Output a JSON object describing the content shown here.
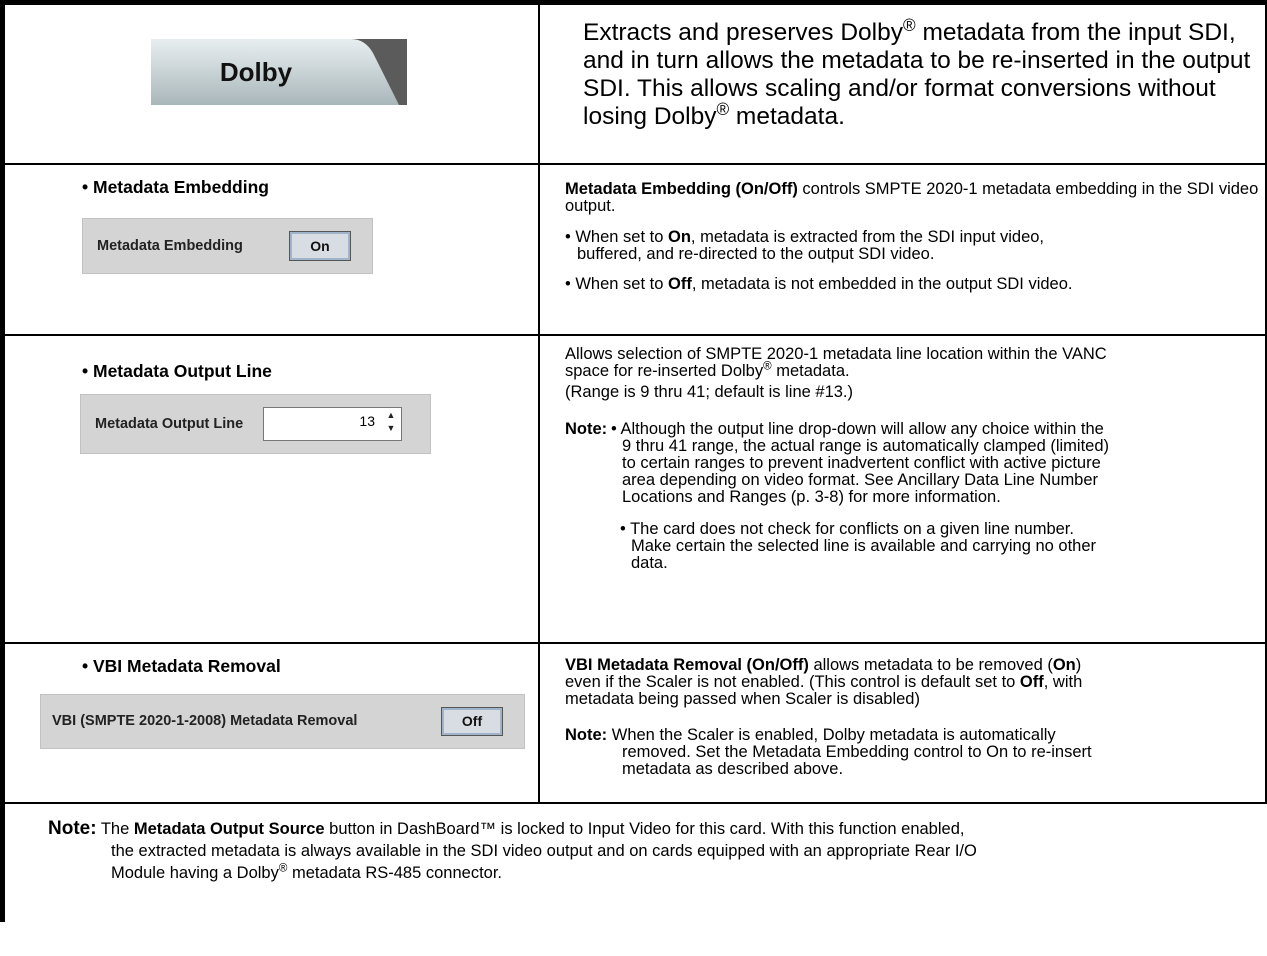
{
  "header": {
    "tab_label": "Dolby",
    "intro_p1": "Extracts and preserves Dolby",
    "intro_p2": " metadata from the input SDI, and in turn allows the metadata to be re-inserted in the output SDI. This allows scaling and/or format conversions without losing Dolby",
    "intro_p3": " metadata.",
    "reg": "®"
  },
  "embedding": {
    "title": "• Metadata Embedding",
    "control_label": "Metadata Embedding",
    "control_value": "On",
    "desc_bold": "Metadata Embedding (On/Off)",
    "desc_rest": " controls SMPTE 2020-1 metadata embedding in the SDI video output.",
    "b1_pre": "• When set to ",
    "b1_bold": "On",
    "b1_post": ", metadata is extracted from the SDI input video,",
    "b1_line2": "buffered, and re-directed to the output SDI video.",
    "b2_pre": "• When set to ",
    "b2_bold": "Off",
    "b2_post": ", metadata is not embedded in the output SDI video."
  },
  "output_line": {
    "title": "• Metadata Output Line",
    "control_label": "Metadata Output Line",
    "control_value": "13",
    "desc_l1": "Allows selection of SMPTE 2020-1 metadata line location within the VANC",
    "desc_l2a": "space for re-inserted Dolby",
    "desc_l2b": " metadata.",
    "range": "(Range is 9 thru 41; default is line #13.)",
    "note_label": "Note:",
    "note1_l1": "• Although the output line drop-down will allow any choice within the",
    "note1_l2": "9 thru 41 range, the actual range is automatically clamped (limited)",
    "note1_l3": "to certain ranges to prevent inadvertent conflict with active picture",
    "note1_l4": "area depending on video format. See Ancillary Data Line Number",
    "note1_l5": "Locations and Ranges (p. 3-8) for more information.",
    "note2_l1": "• The card does not check for conflicts on a given line number.",
    "note2_l2": "Make certain the selected line is available and carrying no other",
    "note2_l3": "data."
  },
  "vbi": {
    "title": "• VBI Metadata Removal",
    "control_label": "VBI (SMPTE 2020-1-2008) Metadata Removal",
    "control_value": "Off",
    "d_bold1": "VBI Metadata Removal (On/Off)",
    "d_t1": " allows metadata to be removed (",
    "d_bold2": "On",
    "d_t2": ")",
    "d_l2a": "even if the Scaler is not enabled. (This control is default set to ",
    "d_bold3": "Off",
    "d_l2b": ", with",
    "d_l3": "metadata being passed when Scaler is disabled)",
    "note_label": "Note:",
    "note_l1": " When the Scaler is enabled, Dolby metadata is automatically",
    "note_l2": "removed. Set the Metadata Embedding control to On to re-insert",
    "note_l3": "metadata as described above."
  },
  "footer": {
    "note_label": "Note:",
    "t1": " The ",
    "bold1": "Metadata Output Source",
    "t2": " button in DashBoard™ is locked to Input Video for this card. With this function enabled,",
    "l2": "the extracted metadata is always available in the SDI video output and on cards equipped with an appropriate Rear I/O",
    "l3a": "Module having a Dolby",
    "l3b": " metadata RS-485 connector."
  }
}
